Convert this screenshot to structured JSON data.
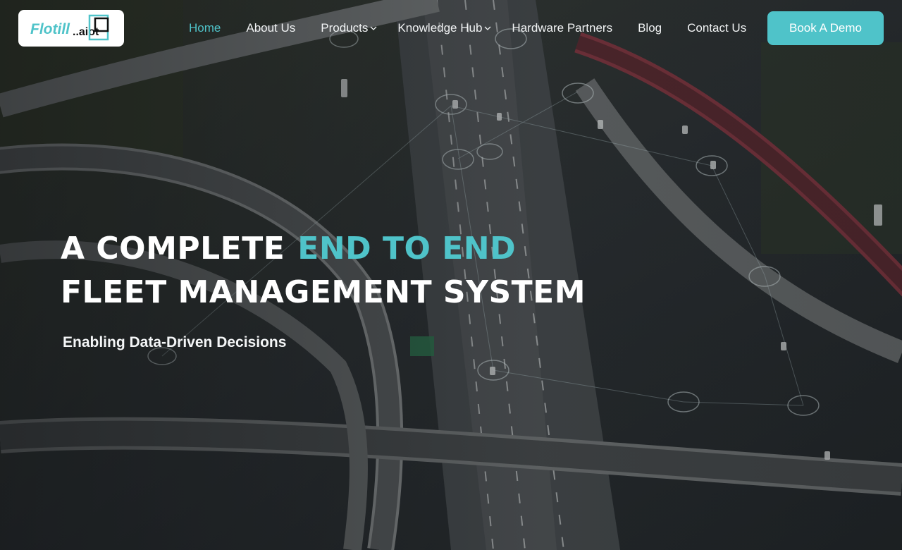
{
  "header": {
    "logo_text": "FlotillaIoT",
    "nav": [
      {
        "label": "Home",
        "active": true,
        "dropdown": false
      },
      {
        "label": "About Us",
        "active": false,
        "dropdown": false
      },
      {
        "label": "Products",
        "active": false,
        "dropdown": true
      },
      {
        "label": "Knowledge Hub",
        "active": false,
        "dropdown": true
      },
      {
        "label": "Hardware Partners",
        "active": false,
        "dropdown": false
      },
      {
        "label": "Blog",
        "active": false,
        "dropdown": false
      },
      {
        "label": "Contact Us",
        "active": false,
        "dropdown": false
      }
    ],
    "cta_label": "Book A Demo"
  },
  "hero": {
    "headline_part1": "A COMPLETE",
    "headline_accent": "END TO END",
    "headline_line2": "FLEET MANAGEMENT SYSTEM",
    "tagline": "Enabling Data-Driven Decisions"
  },
  "colors": {
    "accent": "#4fc3c9",
    "text": "#ffffff"
  }
}
